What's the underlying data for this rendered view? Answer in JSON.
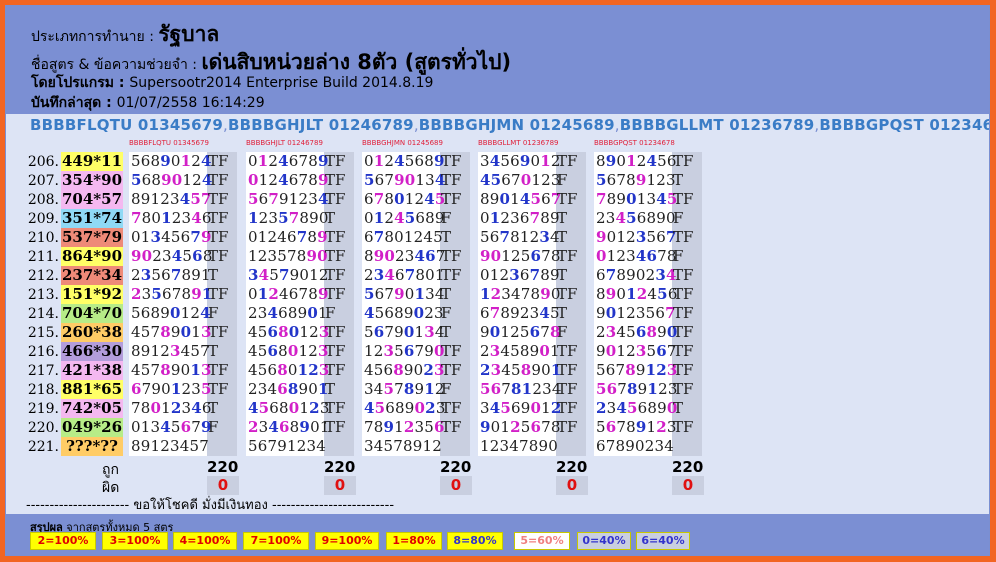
{
  "header": {
    "line1_label": "ประเภทการทำนาย : ",
    "line1_value": "รัฐบาล",
    "line2_label": "ชื่อสูตร & ข้อความช่วยจำ : ",
    "line2_value": "เด่นสิบหน่วยล่าง 8ตัว (สูตรทั่วไป)",
    "line3_label": "โดยโปรแกรม : ",
    "line3_value": "Supersootr2014 Enterprise Build 2014.8.19",
    "line4_label": "บันทึกล่าสุด : ",
    "line4_value": "01/07/2558 16:14:29"
  },
  "formula_line": [
    "BBBBFLQTU 01345679",
    "BBBBGHJLT 01246789",
    "BBBBGHJMN 01245689",
    "BBBBGLLMT 01236789",
    "BBBBGPQST 01234678"
  ],
  "formula_sep": ",",
  "col_headers": [
    "BBBBFLQTU 01345679",
    "BBBBGHJLT 01246789",
    "BBBBGHJMN 01245689",
    "BBBBGLLMT 01236789",
    "BBBBGPQST 01234678"
  ],
  "rows": [
    {
      "n": "206.",
      "pair": "449*11",
      "color": "#ffff66",
      "cells": [
        [
          "56890124",
          "TF"
        ],
        [
          "01246789",
          "TF"
        ],
        [
          "01245689",
          "TF"
        ],
        [
          "34569012",
          "TF"
        ],
        [
          "89012456",
          "TF"
        ]
      ]
    },
    {
      "n": "207.",
      "pair": "354*90",
      "color": "#f4b8f0",
      "cells": [
        [
          "56890124",
          "TF"
        ],
        [
          "01246789",
          "TF"
        ],
        [
          "56790134",
          "TF"
        ],
        [
          "45670123",
          "F"
        ],
        [
          "56789123",
          "T"
        ]
      ]
    },
    {
      "n": "208.",
      "pair": "704*57",
      "color": "#f4b8f0",
      "cells": [
        [
          "89123457",
          "TF"
        ],
        [
          "56791234",
          "TF"
        ],
        [
          "67801245",
          "TF"
        ],
        [
          "89014567",
          "TF"
        ],
        [
          "78901345",
          "TF"
        ]
      ]
    },
    {
      "n": "209.",
      "pair": "351*74",
      "color": "#8fd9f5",
      "cells": [
        [
          "78012346",
          "TF"
        ],
        [
          "12357890",
          "T"
        ],
        [
          "01245689",
          "F"
        ],
        [
          "01236789",
          "T"
        ],
        [
          "23456890",
          "F"
        ]
      ]
    },
    {
      "n": "210.",
      "pair": "537*79",
      "color": "#ee8a78",
      "cells": [
        [
          "01345679",
          "TF"
        ],
        [
          "01246789",
          "TF"
        ],
        [
          "67801245",
          "T"
        ],
        [
          "56781234",
          "T"
        ],
        [
          "90123567",
          "TF"
        ]
      ]
    },
    {
      "n": "211.",
      "pair": "864*90",
      "color": "#ffff66",
      "cells": [
        [
          "90234568",
          "TF"
        ],
        [
          "12357890",
          "TF"
        ],
        [
          "89023467",
          "TF"
        ],
        [
          "90125678",
          "TF"
        ],
        [
          "01234678",
          "F"
        ]
      ]
    },
    {
      "n": "212.",
      "pair": "237*34",
      "color": "#ee8a78",
      "cells": [
        [
          "23567891",
          "T"
        ],
        [
          "34579012",
          "TF"
        ],
        [
          "23467801",
          "TF"
        ],
        [
          "01236789",
          "T"
        ],
        [
          "67890234",
          "TF"
        ]
      ]
    },
    {
      "n": "213.",
      "pair": "151*92",
      "color": "#ffff66",
      "cells": [
        [
          "23567891",
          "TF"
        ],
        [
          "01246789",
          "TF"
        ],
        [
          "56790134",
          "T"
        ],
        [
          "12347890",
          "TF"
        ],
        [
          "89012456",
          "TF"
        ]
      ]
    },
    {
      "n": "214.",
      "pair": "704*70",
      "color": "#b7ec87",
      "cells": [
        [
          "56890124",
          "F"
        ],
        [
          "23468901",
          "F"
        ],
        [
          "45689023",
          "F"
        ],
        [
          "67892345",
          "T"
        ],
        [
          "90123567",
          "TF"
        ]
      ]
    },
    {
      "n": "215.",
      "pair": "260*38",
      "color": "#ffcc66",
      "cells": [
        [
          "45789013",
          "TF"
        ],
        [
          "45680123",
          "TF"
        ],
        [
          "56790134",
          "T"
        ],
        [
          "90125678",
          "F"
        ],
        [
          "23456890",
          "TF"
        ]
      ]
    },
    {
      "n": "216.",
      "pair": "466*30",
      "color": "#b39ddb",
      "cells": [
        [
          "89123457",
          "T"
        ],
        [
          "45680123",
          "TF"
        ],
        [
          "12356790",
          "TF"
        ],
        [
          "23458901",
          "TF"
        ],
        [
          "90123567",
          "TF"
        ]
      ]
    },
    {
      "n": "217.",
      "pair": "421*38",
      "color": "#f4b8f0",
      "cells": [
        [
          "45789013",
          "TF"
        ],
        [
          "45680123",
          "TF"
        ],
        [
          "45689023",
          "TF"
        ],
        [
          "23458901",
          "TF"
        ],
        [
          "56789123",
          "TF"
        ]
      ]
    },
    {
      "n": "218.",
      "pair": "881*65",
      "color": "#ffff66",
      "cells": [
        [
          "67901235",
          "TF"
        ],
        [
          "23468901",
          "T"
        ],
        [
          "34578912",
          "F"
        ],
        [
          "56781234",
          "TF"
        ],
        [
          "56789123",
          "TF"
        ]
      ]
    },
    {
      "n": "219.",
      "pair": "742*05",
      "color": "#f4b8f0",
      "cells": [
        [
          "78012346",
          "T"
        ],
        [
          "45680123",
          "TF"
        ],
        [
          "45689023",
          "TF"
        ],
        [
          "34569012",
          "TF"
        ],
        [
          "23456890",
          "T"
        ]
      ]
    },
    {
      "n": "220.",
      "pair": "049*26",
      "color": "#b7ec87",
      "cells": [
        [
          "01345679",
          "F"
        ],
        [
          "23468901",
          "TF"
        ],
        [
          "78912356",
          "TF"
        ],
        [
          "90125678",
          "TF"
        ],
        [
          "56789123",
          "TF"
        ]
      ]
    },
    {
      "n": "221.",
      "pair": "???*??",
      "color": "#ffcc66",
      "cells": [
        [
          "89123457",
          ""
        ],
        [
          "56791234",
          ""
        ],
        [
          "34578912",
          ""
        ],
        [
          "12347890",
          ""
        ],
        [
          "67890234",
          ""
        ]
      ]
    }
  ],
  "summary": {
    "correct_label": "ถูก",
    "wrong_label": "ผิด",
    "correct": [
      "220",
      "220",
      "220",
      "220",
      "220"
    ],
    "wrong": [
      "0",
      "0",
      "0",
      "0",
      "0"
    ]
  },
  "luck_line": "---------------------- ขอให้โชคดี มั่งมีเงินทอง --------------------------",
  "footer": {
    "title_bold": "สรุปผล",
    "title_rest": " จากสูตรทั้งหมด 5 สูตร",
    "chips": [
      {
        "label": "2=100%",
        "bg": "#ffff00",
        "fg": "#e00000"
      },
      {
        "label": "3=100%",
        "bg": "#ffff00",
        "fg": "#e00000"
      },
      {
        "label": "4=100%",
        "bg": "#ffff00",
        "fg": "#e00000"
      },
      {
        "label": "7=100%",
        "bg": "#ffff00",
        "fg": "#e00000"
      },
      {
        "label": "9=100%",
        "bg": "#ffff00",
        "fg": "#e00000"
      },
      {
        "label": "1=80%",
        "bg": "#ffff00",
        "fg": "#e00000"
      },
      {
        "label": "8=80%",
        "bg": "#ffff00",
        "fg": "#3333cc"
      },
      {
        "label": "5=60%",
        "bg": "#ffffff",
        "fg": "#f08080"
      },
      {
        "label": "0=40%",
        "bg": "#c9cfe0",
        "fg": "#3333cc"
      },
      {
        "label": "6=40%",
        "bg": "#c9cfe0",
        "fg": "#3333cc"
      }
    ]
  }
}
